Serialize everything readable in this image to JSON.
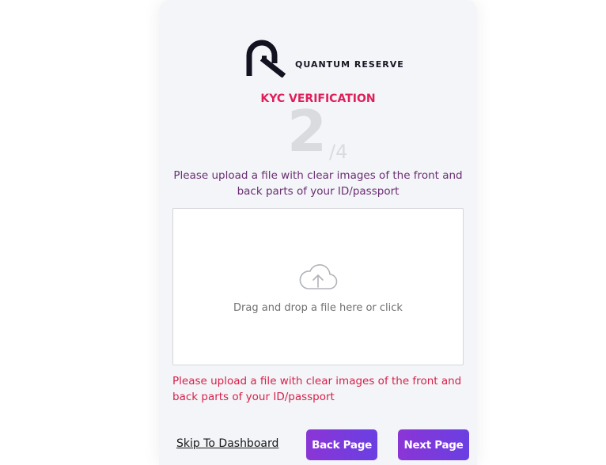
{
  "brand": {
    "logo_text": "QUANTUM RESERVE",
    "logo_icon": "qr-logo-icon"
  },
  "header": {
    "title": "KYC VERIFICATION"
  },
  "step": {
    "current": "2",
    "total": "/4"
  },
  "instructions": "Please upload a file with clear images of the front and back parts of your ID/passport",
  "dropzone": {
    "icon": "cloud-upload-icon",
    "text": "Drag and drop a file here or click"
  },
  "error_message": "Please upload a file with clear images of the front and back parts of your ID/passport",
  "actions": {
    "skip_label": "Skip To Dashboard",
    "back_label": "Back Page",
    "next_label": "Next Page"
  },
  "colors": {
    "accent_title": "#e01e5a",
    "instruction_text": "#6b2e73",
    "error_text": "#d81f4a",
    "button_gradient_start": "#8b35d6",
    "button_gradient_end": "#6a3fe2"
  }
}
